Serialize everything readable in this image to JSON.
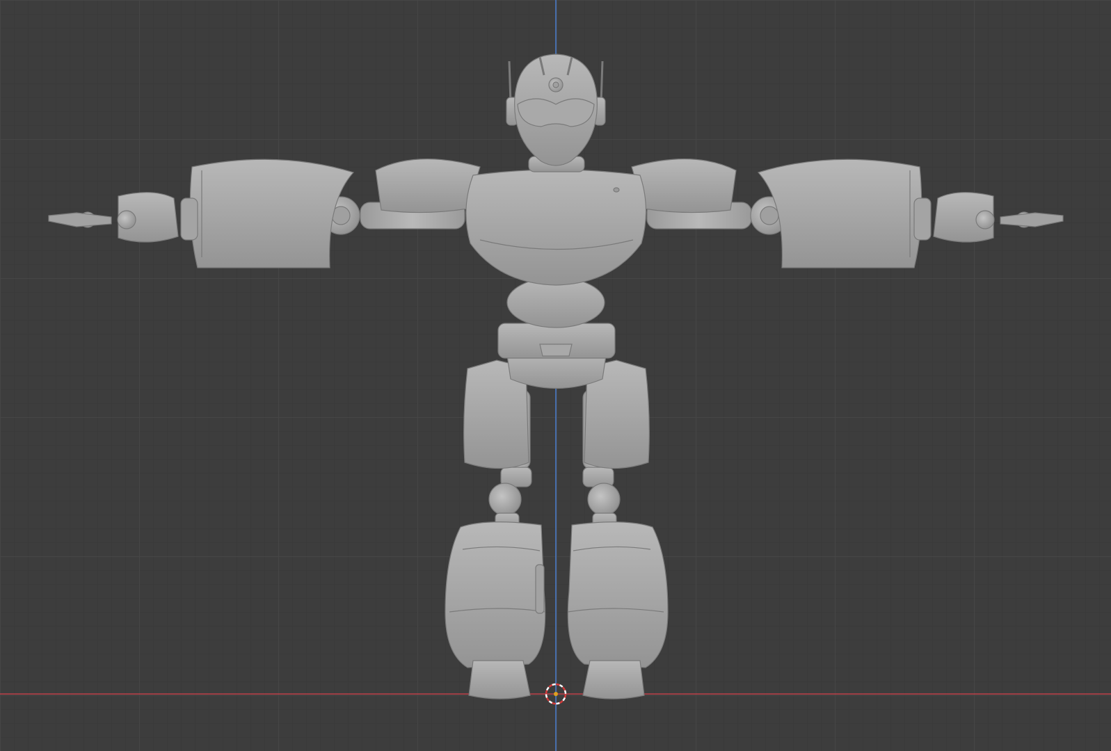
{
  "viewport": {
    "view": "front-orthographic",
    "background_color": "#3d3d3d",
    "grid_color": "#474747",
    "x_axis_color": "#c0404a",
    "z_axis_color": "#4a7ed0",
    "mesh_color": "#a7a7a7",
    "mesh_outline_color": "#7a7a7a",
    "object": "robot-mesh",
    "pose": "t-pose",
    "icons": [
      "3d-cursor-icon"
    ]
  }
}
